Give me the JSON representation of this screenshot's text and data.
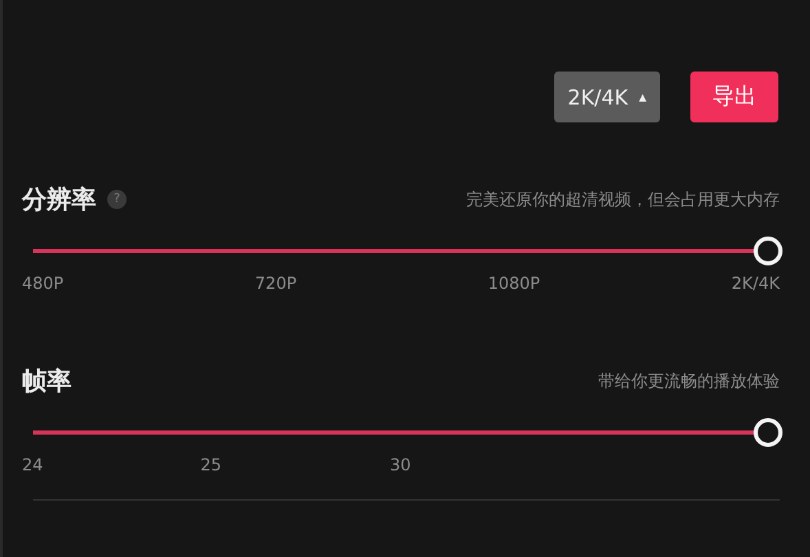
{
  "toolbar": {
    "quality_dropdown": {
      "label": "2K/4K",
      "caret": "▲"
    },
    "export_button": {
      "label": "导出"
    }
  },
  "settings": [
    {
      "title": "分辨率",
      "help": "?",
      "description": "完美还原你的超清视频，但会占用更大内存",
      "level": 1,
      "ticks": [
        "480P",
        "720P",
        "1080P",
        "2K/4K"
      ]
    },
    {
      "title": "帧率",
      "description": "带给你更流畅的播放体验",
      "level": 1,
      "ticks": [
        "24",
        "25",
        "30"
      ]
    }
  ]
}
